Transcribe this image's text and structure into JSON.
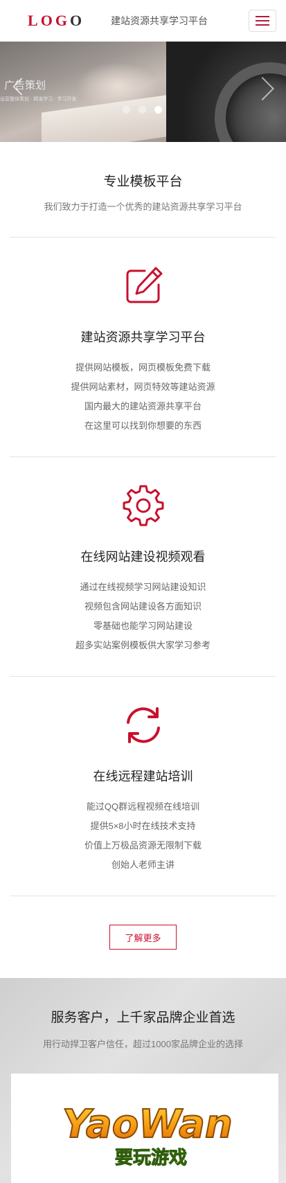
{
  "header": {
    "logo_text": "LOGO",
    "site_title": "建站资源共享学习平台",
    "menu_icon": "hamburger-menu-icon"
  },
  "banner": {
    "caption": "广告策划",
    "subcaption": "运营整体策划 · 精准学习 · 学习开发",
    "dots": 3,
    "active_dot": 3
  },
  "intro": {
    "title": "专业模板平台",
    "subtitle": "我们致力于打造一个优秀的建站资源共享学习平台"
  },
  "features": [
    {
      "icon": "pencil-edit-icon",
      "title": "建站资源共享学习平台",
      "lines": [
        "提供网站模板，网页模板免费下载",
        "提供网站素材，网页特效等建站资源",
        "国内最大的建站资源共享平台",
        "在这里可以找到你想要的东西"
      ]
    },
    {
      "icon": "gear-icon",
      "title": "在线网站建设视频观看",
      "lines": [
        "通过在线视频学习网站建设知识",
        "视频包含网站建设各方面知识",
        "零基础也能学习网站建设",
        "超多实站案例模板供大家学习参考"
      ]
    },
    {
      "icon": "refresh-icon",
      "title": "在线远程建站培训",
      "lines": [
        "能过QQ群远程视频在线培训",
        "提供5×8小时在线技术支持",
        "价值上万极品资源无限制下载",
        "创始人老师主讲"
      ]
    }
  ],
  "more_button": {
    "label": "了解更多"
  },
  "clients": {
    "title": "服务客户，上千家品牌企业首选",
    "subtitle": "用行动捍卫客户信任，超过1000家品牌企业的选择",
    "logo_word": "YaoWan",
    "logo_sub": "要玩游戏"
  },
  "colors": {
    "accent": "#c8102e",
    "text_dark": "#222222",
    "text_muted": "#777777"
  }
}
